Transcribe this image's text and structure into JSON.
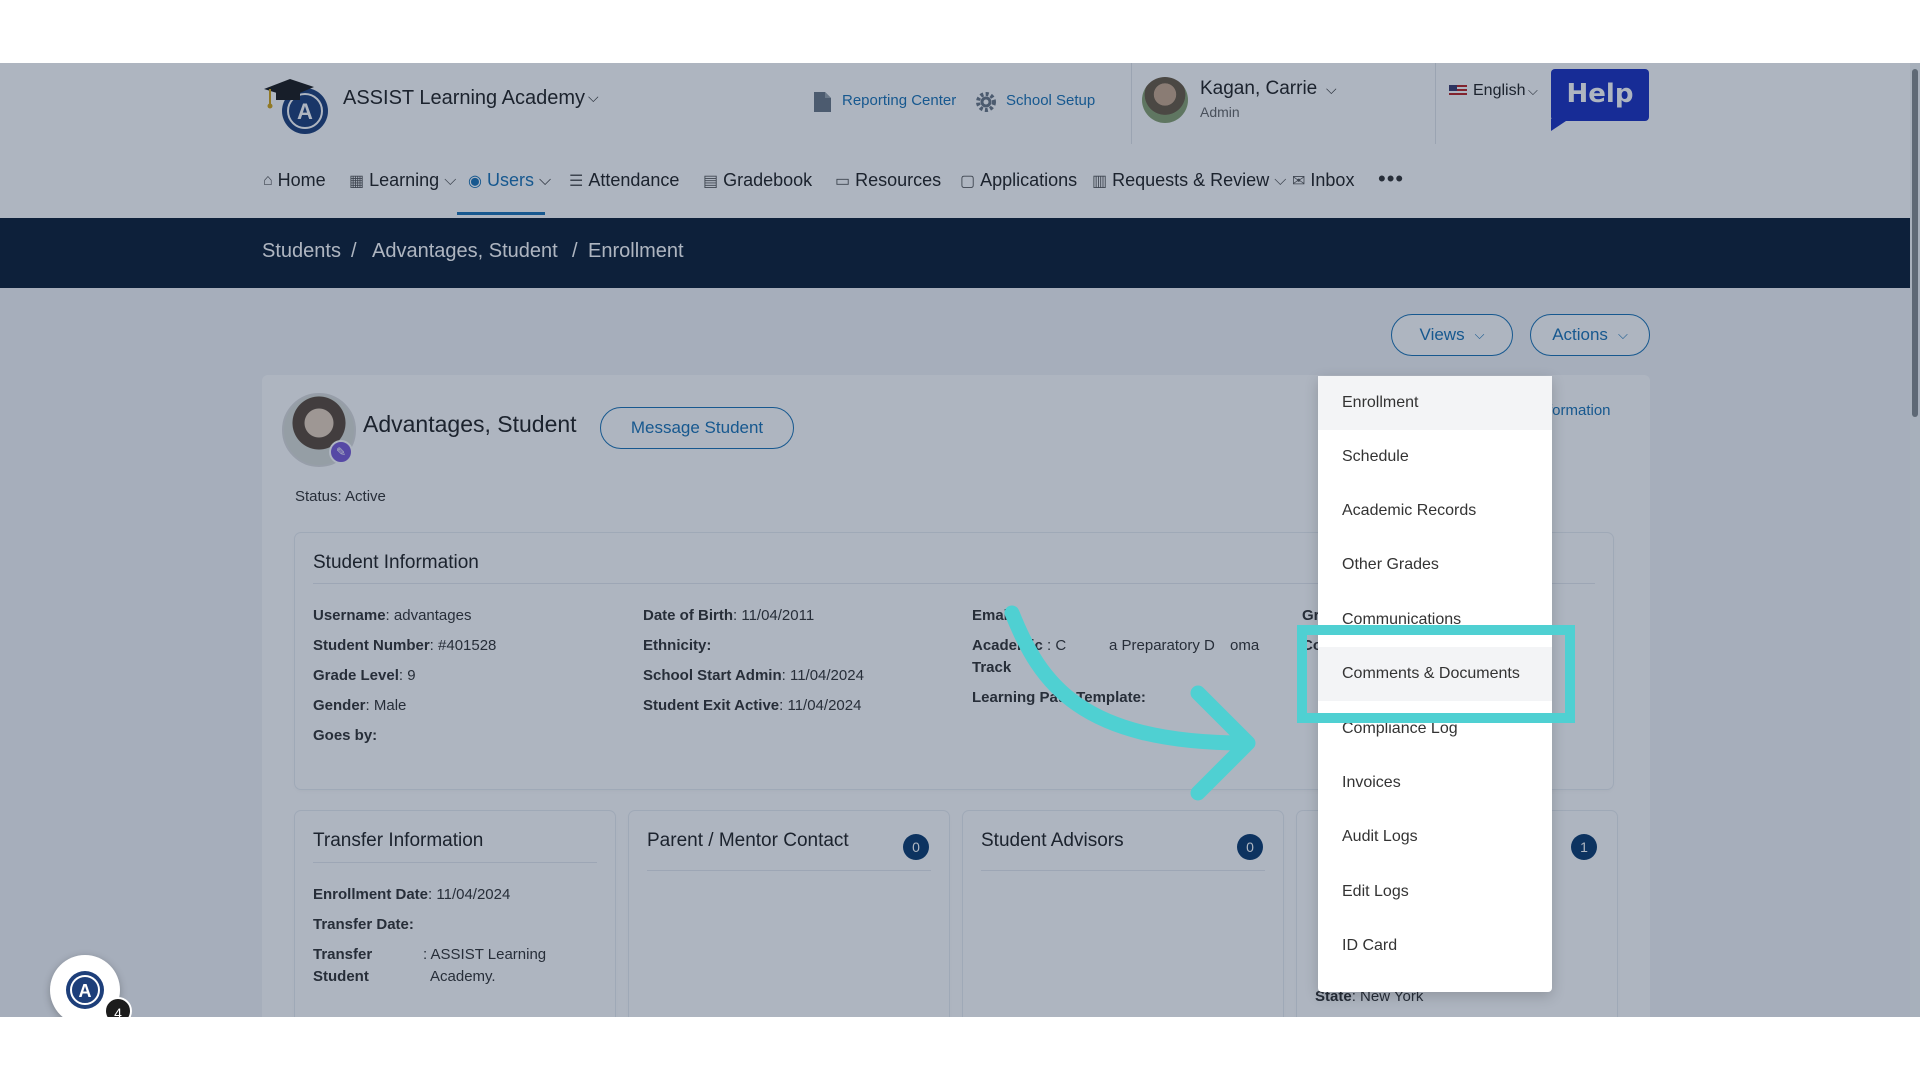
{
  "header": {
    "school_name": "ASSIST Learning Academy",
    "reporting_center": "Reporting Center",
    "school_setup": "School Setup",
    "user_name": "Kagan, Carrie",
    "user_role": "Admin",
    "language": "English",
    "help_label": "Help"
  },
  "nav": {
    "home": "Home",
    "learning": "Learning",
    "users": "Users",
    "attendance": "Attendance",
    "gradebook": "Gradebook",
    "resources": "Resources",
    "applications": "Applications",
    "requests_review": "Requests & Review",
    "inbox": "Inbox",
    "more": "•••"
  },
  "breadcrumb": {
    "students": "Students",
    "sep1": "/",
    "student": "Advantages, Student",
    "sep2": "/",
    "current": "Enrollment"
  },
  "toolbar": {
    "views_label": "Views",
    "actions_label": "Actions"
  },
  "student": {
    "name": "Advantages, Student",
    "message_button": "Message Student",
    "status_label": "Status:",
    "status_value": "Active",
    "info_link_fragment": "formation"
  },
  "student_info": {
    "title": "Student Information",
    "username_label": "Username",
    "username_value": ": advantages",
    "number_label": "Student Number",
    "number_value": ": #401528",
    "grade_label": "Grade Level",
    "grade_value": ": 9",
    "gender_label": "Gender",
    "gender_value": ": Male",
    "goes_by_label": "Goes by:",
    "dob_label": "Date of Birth",
    "dob_value": ": 11/04/2011",
    "ethnicity_label": "Ethnicity:",
    "start_label": "School Start Admin",
    "start_value": ": 11/04/2024",
    "exit_label": "Student Exit Active",
    "exit_value": ": 11/04/2024",
    "email_label": "Email:",
    "academic_label": "Academic",
    "academic_track": "Track",
    "academic_value": ": C",
    "academic_value_mid": "a Preparatory D",
    "academic_value_end": "oma",
    "lpt_label": "Learning Path Template:",
    "col4_fragment1": "Gr",
    "col4_fragment2": "Co"
  },
  "transfer": {
    "title": "Transfer Information",
    "enroll_label": "Enrollment Date",
    "enroll_value": ": 11/04/2024",
    "transfer_date_label": "Transfer Date:",
    "transfer_student_label1": "Transfer",
    "transfer_student_label2": "Student",
    "transfer_student_value1": ": ASSIST Learning",
    "transfer_student_value2": "Academy."
  },
  "parent": {
    "title": "Parent / Mentor Contact",
    "count": "0"
  },
  "advisors": {
    "title": "Student Advisors",
    "count": "0"
  },
  "fourth_panel": {
    "count": "1",
    "state_label": "State",
    "state_value": ": New York"
  },
  "views_menu": {
    "items": [
      "Enrollment",
      "Schedule",
      "Academic Records",
      "Other Grades",
      "Communications",
      "Comments & Documents",
      "Compliance Log",
      "Invoices",
      "Audit Logs",
      "Edit Logs",
      "ID Card"
    ],
    "selected": "Enrollment",
    "highlighted": "Comments & Documents"
  },
  "widget": {
    "badge_count": "4"
  },
  "colors": {
    "primary": "#1a73b5",
    "navy": "#0b1e35",
    "highlight": "#4fd0d2",
    "help": "#1a2fbf"
  }
}
